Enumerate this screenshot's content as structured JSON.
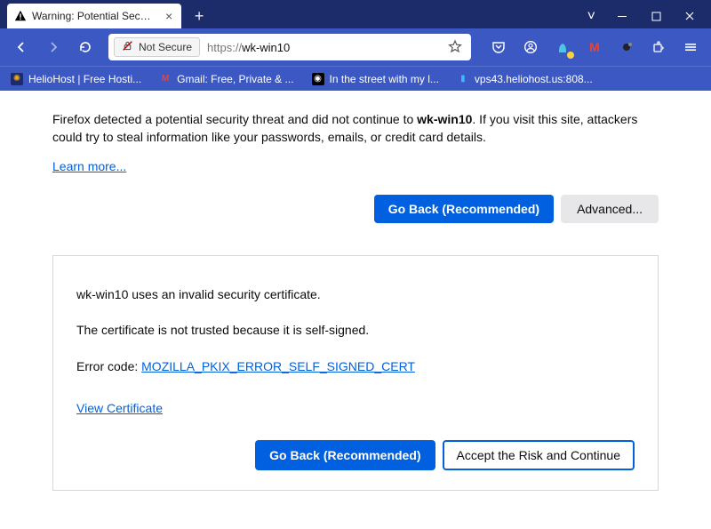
{
  "window": {
    "tab_title": "Warning: Potential Security Risk",
    "chevron": "˅",
    "min": "—",
    "max": "☐",
    "close": "✕"
  },
  "urlbar": {
    "security_label": "Not Secure",
    "scheme": "https://",
    "host": "wk-win10"
  },
  "bookmarks": [
    {
      "label": "HelioHost | Free Hosti...",
      "fav_bg": "#f5a623",
      "fav_fg": "#fff",
      "glyph": "✺"
    },
    {
      "label": "Gmail: Free, Private & ...",
      "fav_bg": "#1c2c6b",
      "fav_fg": "#ea4335",
      "glyph": "M"
    },
    {
      "label": "In the street with my l...",
      "fav_bg": "#000",
      "fav_fg": "#fff",
      "glyph": "◉"
    },
    {
      "label": "vps43.heliohost.us:808...",
      "fav_bg": "#1c2c6b",
      "fav_fg": "#3fb6ff",
      "glyph": "▮"
    }
  ],
  "main": {
    "warning_pre": "Firefox detected a potential security threat and did not continue to ",
    "warning_host": "wk-win10",
    "warning_post": ". If you visit this site, attackers could try to steal information like your passwords, emails, or credit card details.",
    "learn_more": "Learn more...",
    "go_back": "Go Back (Recommended)",
    "advanced": "Advanced..."
  },
  "advanced_panel": {
    "line1": "wk-win10 uses an invalid security certificate.",
    "line2": "The certificate is not trusted because it is self-signed.",
    "error_label": "Error code: ",
    "error_code": "MOZILLA_PKIX_ERROR_SELF_SIGNED_CERT",
    "view_cert": "View Certificate",
    "go_back": "Go Back (Recommended)",
    "accept": "Accept the Risk and Continue"
  }
}
